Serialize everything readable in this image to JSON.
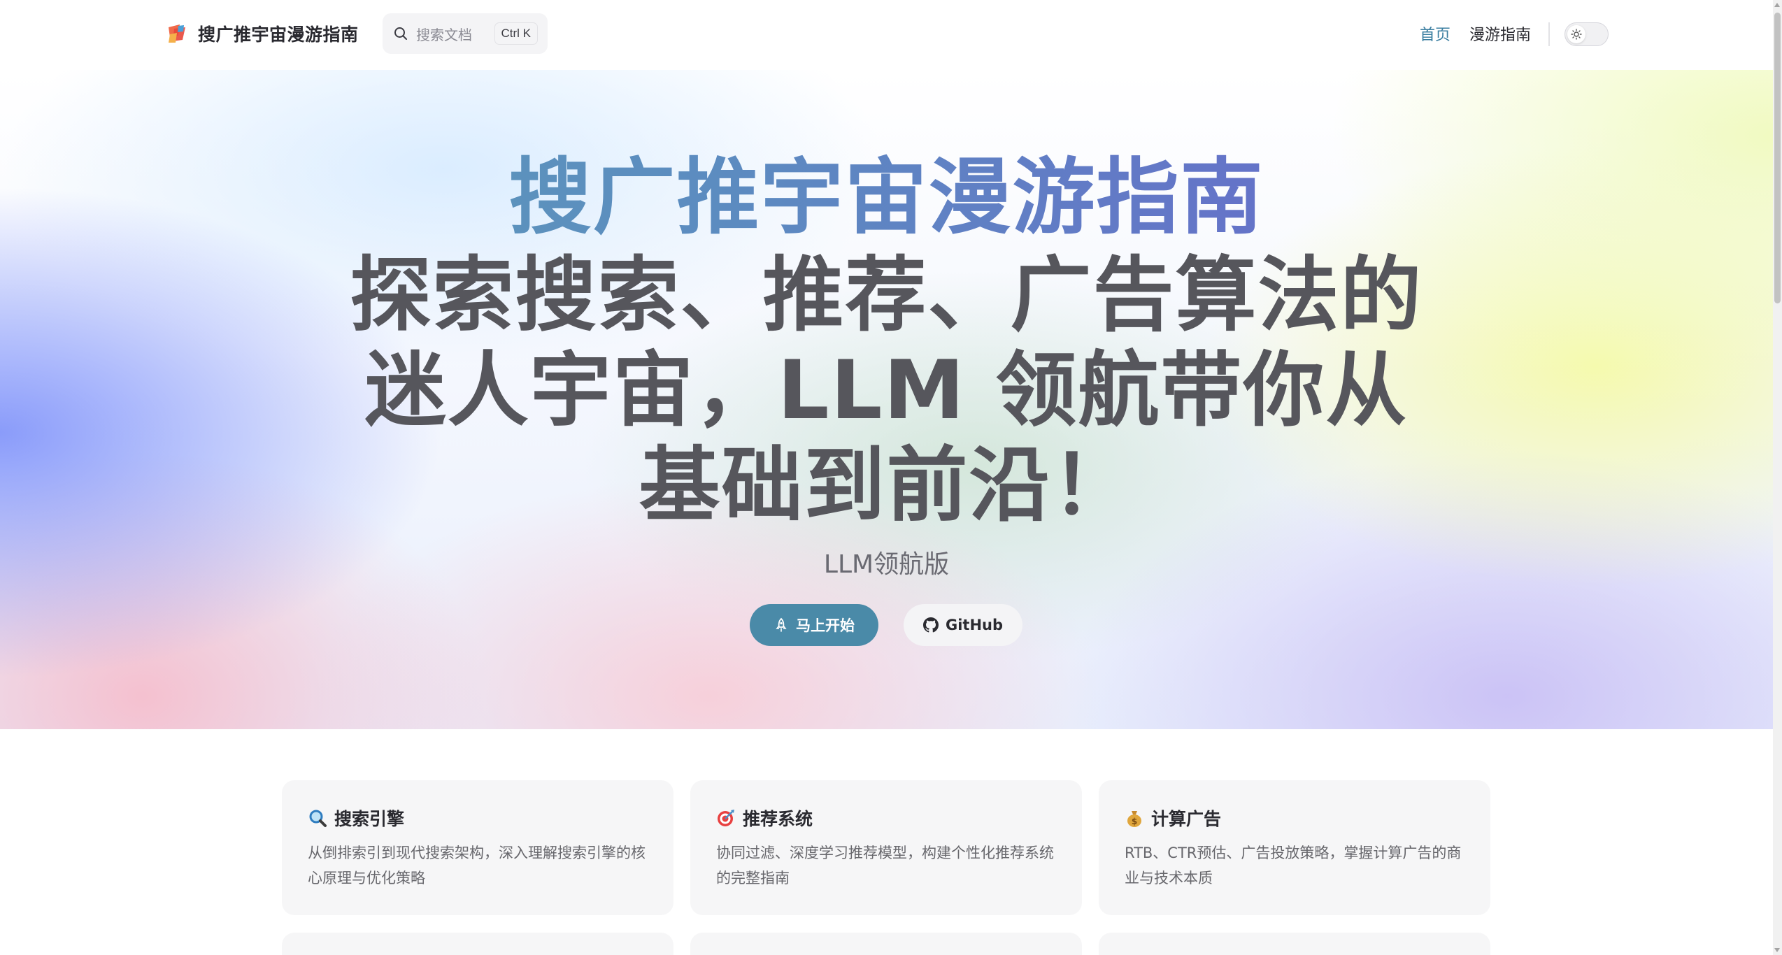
{
  "nav": {
    "brand_title": "搜广推宇宙漫游指南",
    "search_placeholder": "搜索文档",
    "search_shortcut": "Ctrl K",
    "links": [
      {
        "label": "首页"
      },
      {
        "label": "漫游指南"
      }
    ],
    "theme_icon": "sun-icon"
  },
  "hero": {
    "title": "搜广推宇宙漫游指南",
    "tagline": "探索搜索、推荐、广告算法的迷人宇宙，LLM 领航带你从基础到前沿！",
    "subtitle": "LLM领航版",
    "primary_button": "马上开始",
    "secondary_button": "GitHub"
  },
  "features": [
    {
      "icon": "magnifier-emoji-icon",
      "title": "搜索引擎",
      "desc": "从倒排索引到现代搜索架构，深入理解搜索引擎的核心原理与优化策略"
    },
    {
      "icon": "target-emoji-icon",
      "title": "推荐系统",
      "desc": "协同过滤、深度学习推荐模型，构建个性化推荐系统的完整指南"
    },
    {
      "icon": "money-bag-emoji-icon",
      "title": "计算广告",
      "desc": "RTB、CTR预估、广告投放策略，掌握计算广告的商业与技术本质"
    }
  ],
  "colors": {
    "accent": "#4a8aa8",
    "active_link": "#3a7ea0",
    "title_gradient_start": "#5aa0b4",
    "title_gradient_end": "#6c5cd0"
  }
}
